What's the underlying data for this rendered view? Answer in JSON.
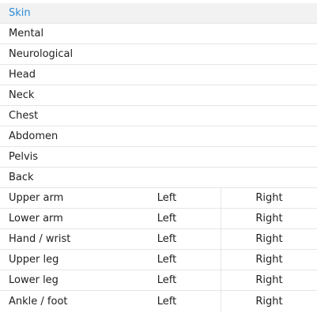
{
  "body_parts": {
    "single": [
      {
        "label": "Skin",
        "selected": true
      },
      {
        "label": "Mental",
        "selected": false
      },
      {
        "label": "Neurological",
        "selected": false
      },
      {
        "label": "Head",
        "selected": false
      },
      {
        "label": "Neck",
        "selected": false
      },
      {
        "label": "Chest",
        "selected": false
      },
      {
        "label": "Abdomen",
        "selected": false
      },
      {
        "label": "Pelvis",
        "selected": false
      },
      {
        "label": "Back",
        "selected": false
      }
    ],
    "sided": [
      {
        "label": "Upper arm",
        "left": "Left",
        "right": "Right"
      },
      {
        "label": "Lower arm",
        "left": "Left",
        "right": "Right"
      },
      {
        "label": "Hand / wrist",
        "left": "Left",
        "right": "Right"
      },
      {
        "label": "Upper leg",
        "left": "Left",
        "right": "Right"
      },
      {
        "label": "Lower leg",
        "left": "Left",
        "right": "Right"
      },
      {
        "label": "Ankle / foot",
        "left": "Left",
        "right": "Right"
      }
    ]
  },
  "colors": {
    "selected_text": "#2a8ad6",
    "selected_bg": "#f2f2f2",
    "divider": "#e6e6e6"
  }
}
